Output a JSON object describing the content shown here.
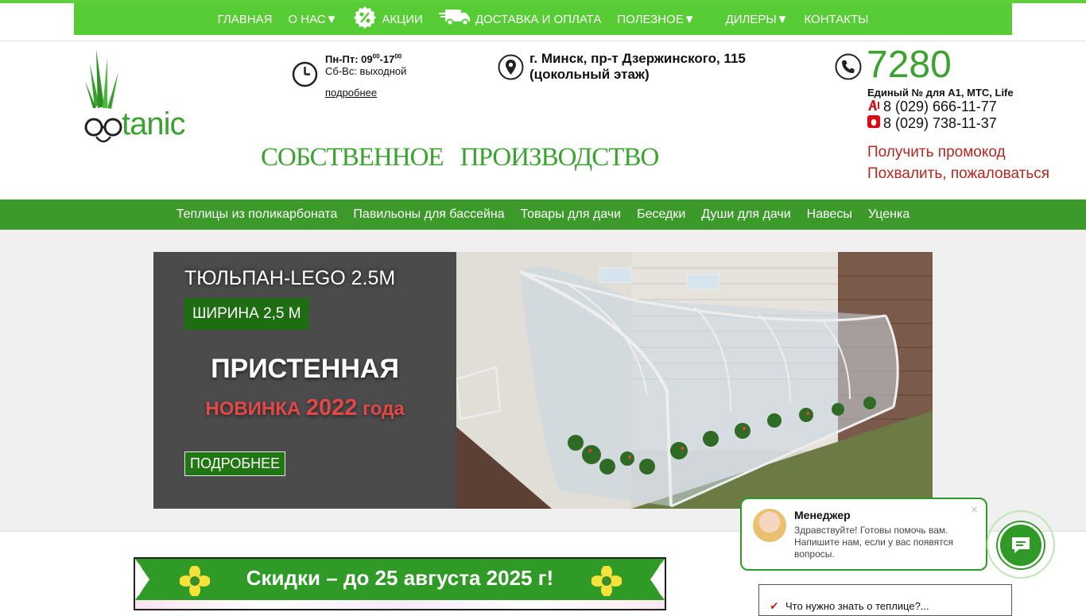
{
  "top_nav": {
    "items": [
      {
        "label": "ГЛАВНАЯ"
      },
      {
        "label": "О НАС▼"
      },
      {
        "label": "АКЦИИ",
        "icon": "percent-icon"
      },
      {
        "label": "ДОСТАВКА И ОПЛАТА",
        "icon": "truck-icon"
      },
      {
        "label": "ПОЛЕЗНОЕ▼"
      },
      {
        "label": "ДИЛЕРЫ▼"
      },
      {
        "label": "КОНТАКТЫ"
      }
    ]
  },
  "header": {
    "logo_text": "botanic",
    "hours_weekday": "Пн-Пт: 09",
    "hours_weekday_sup1": "00",
    "hours_weekday_mid": "-17",
    "hours_weekday_sup2": "00",
    "hours_weekend": "Сб-Вс: выходной",
    "more_link": "подробнее",
    "address_line1": "г. Минск, пр-т Дзержинского, 115",
    "address_line2": "(цокольный этаж)",
    "slogan": "СОБСТВЕННОЕ ПРОИЗВОДСТВО",
    "phone_short": "7280",
    "phone_caption": "Единый № для А1, МТС, Life",
    "phone_a1": "8 (029) 666-11-77",
    "phone_mts": "8 (029) 738-11-37",
    "promo_link": "Получить промокод",
    "feedback_link": "Похвалить, пожаловаться"
  },
  "category_nav": {
    "items": [
      {
        "label": "Теплицы из поликарбоната"
      },
      {
        "label": "Павильоны для бассейна"
      },
      {
        "label": "Товары для дачи"
      },
      {
        "label": "Беседки"
      },
      {
        "label": "Души для дачи"
      },
      {
        "label": "Навесы"
      },
      {
        "label": "Уценка"
      }
    ]
  },
  "slide": {
    "title": "ТЮЛЬПАН-LEGO 2.5М",
    "badge": "ШИРИНА 2,5 М",
    "big_text": "ПРИСТЕННАЯ",
    "new_prefix": "НОВИНКА",
    "new_year": "2022",
    "new_suffix": "года",
    "button": "ПОДРОБНЕЕ"
  },
  "banner": {
    "text": "Скидки – до 25 августа 2025 г!"
  },
  "chat": {
    "name": "Менеджер",
    "message": "Здравствуйте! Готовы помочь вам. Напишите нам, если у вас появятся вопросы.",
    "close": "×"
  },
  "faq": {
    "text": "Что нужно знать о теплице?..."
  },
  "colors": {
    "brand_green": "#57cc34",
    "dark_green": "#3b9a2a",
    "link_red": "#b5271f"
  }
}
